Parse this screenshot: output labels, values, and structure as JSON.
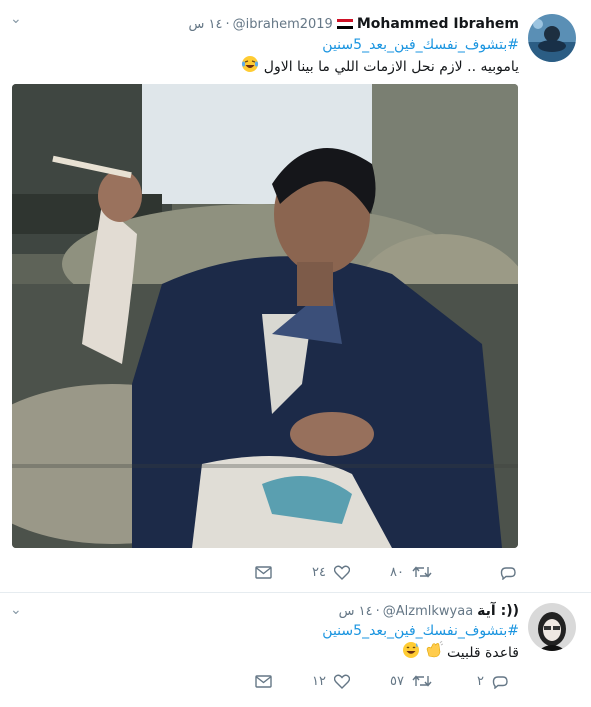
{
  "tweets": [
    {
      "display_name": "Mohammed Ibrahem",
      "handle": "@ibrahem2019",
      "dot": "·",
      "time": "١٤ س",
      "hashtag": "#بتشوف_نفسك_فين_بعد_5سنين",
      "text": "ياموبيه .. لازم نحل الازمات اللي ما بينا الاول",
      "emoji": "laughing-tears-emoji",
      "flag": "egypt-flag",
      "counts": {
        "reply": "",
        "retweet": "٨٠",
        "like": "٢٤"
      },
      "has_photo": true
    },
    {
      "display_name": "آية :))",
      "handle": "@Alzmlkwyaa",
      "dot": "·",
      "time": "١٤ س",
      "hashtag": "#بتشوف_نفسك_فين_بعد_5سنين",
      "text": "قاعدة قلبيت",
      "emoji": "clapping-and-sweat-smile-emoji",
      "counts": {
        "reply": "٢",
        "retweet": "٥٧",
        "like": "١٢"
      },
      "has_photo": false
    }
  ],
  "colors": {
    "link": "#1b95e0",
    "secondary_text": "#657786",
    "primary_text": "#14171a",
    "icon": "#657786",
    "border": "#e6ecf0"
  }
}
